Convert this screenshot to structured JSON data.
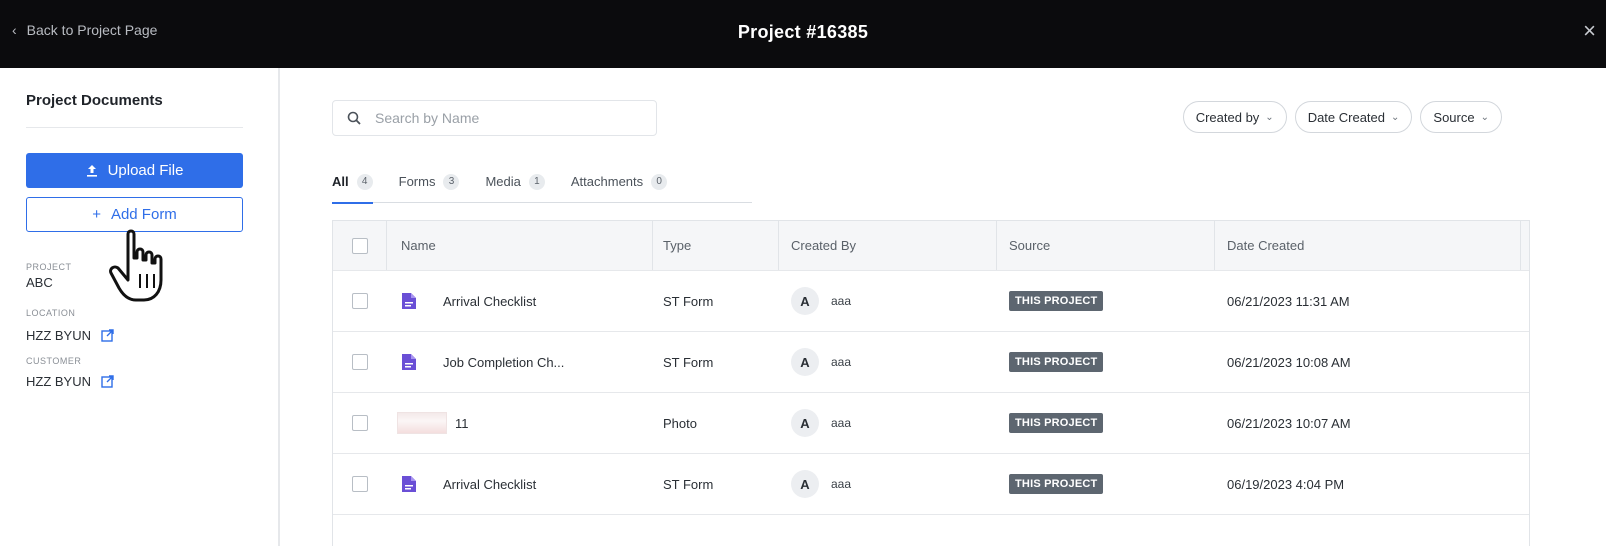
{
  "header": {
    "back_label": "Back to Project Page",
    "title": "Project #16385",
    "close_glyph": "×"
  },
  "sidebar": {
    "title": "Project Documents",
    "upload_label": "Upload File",
    "add_form_label": "Add Form",
    "meta": [
      {
        "label": "PROJECT",
        "value": "ABC",
        "link": false
      },
      {
        "label": "LOCATION",
        "value": "HZZ BYUN",
        "link": true
      },
      {
        "label": "CUSTOMER",
        "value": "HZZ BYUN",
        "link": true
      }
    ]
  },
  "search": {
    "placeholder": "Search by Name",
    "value": ""
  },
  "filters": [
    "Created by",
    "Date Created",
    "Source"
  ],
  "tabs": [
    {
      "label": "All",
      "count": "4",
      "active": true
    },
    {
      "label": "Forms",
      "count": "3",
      "active": false
    },
    {
      "label": "Media",
      "count": "1",
      "active": false
    },
    {
      "label": "Attachments",
      "count": "0",
      "active": false
    }
  ],
  "table": {
    "columns": [
      "Name",
      "Type",
      "Created By",
      "Source",
      "Date Created"
    ],
    "rows": [
      {
        "icon": "form-icon",
        "name": "Arrival Checklist",
        "type": "ST Form",
        "avatar": "A",
        "user": "aaa",
        "source": "THIS PROJECT",
        "date": "06/21/2023 11:31 AM"
      },
      {
        "icon": "form-icon",
        "name": "Job Completion Ch...",
        "type": "ST Form",
        "avatar": "A",
        "user": "aaa",
        "source": "THIS PROJECT",
        "date": "06/21/2023 10:08 AM"
      },
      {
        "icon": "photo-thumbnail",
        "name": "11",
        "type": "Photo",
        "avatar": "A",
        "user": "aaa",
        "source": "THIS PROJECT",
        "date": "06/21/2023 10:07 AM"
      },
      {
        "icon": "form-icon",
        "name": "Arrival Checklist",
        "type": "ST Form",
        "avatar": "A",
        "user": "aaa",
        "source": "THIS PROJECT",
        "date": "06/19/2023 4:04 PM"
      }
    ]
  },
  "colors": {
    "primary": "#2f6ee8",
    "topbar": "#0b0b0d",
    "badge": "#5d6670",
    "form_icon": "#6a4fd6"
  }
}
